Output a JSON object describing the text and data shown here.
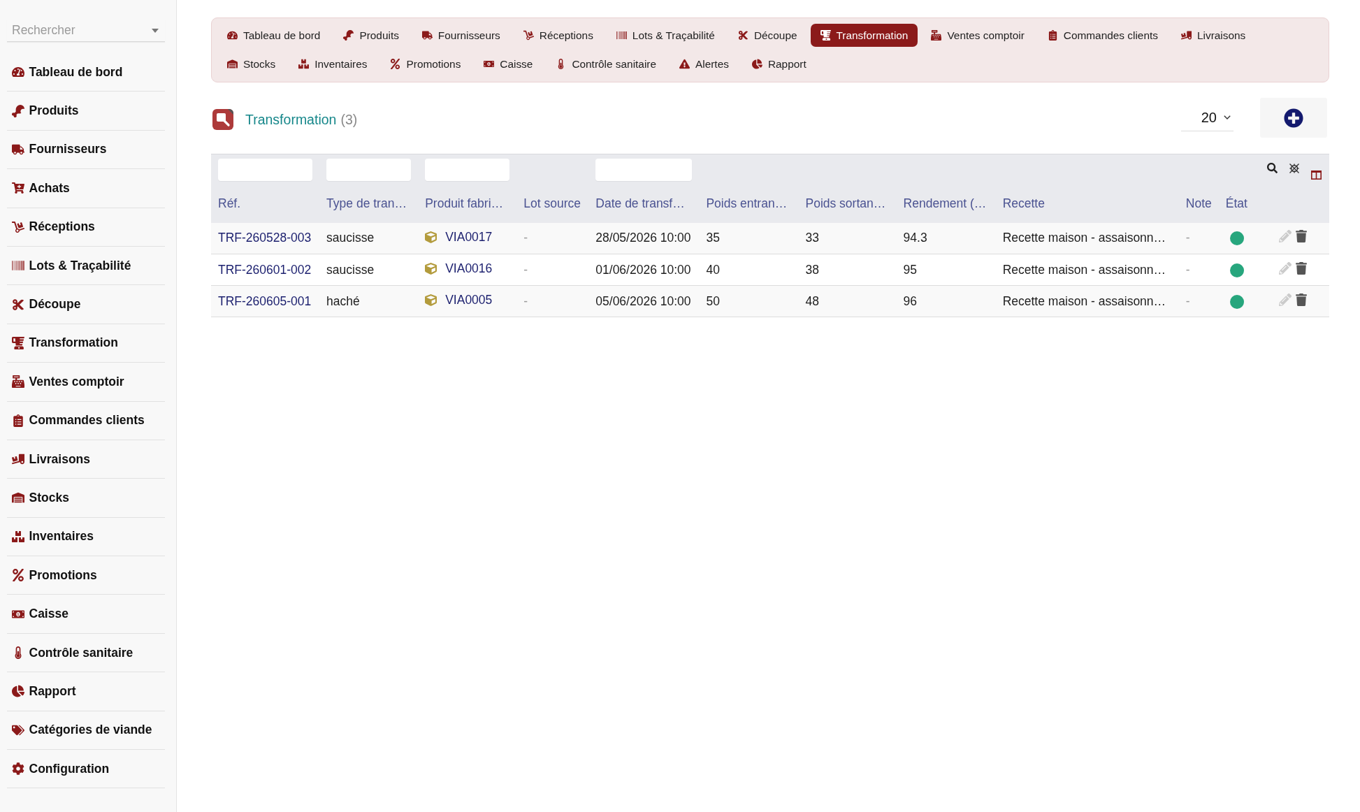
{
  "sidebar": {
    "search": {
      "placeholder": "Rechercher"
    },
    "items": [
      {
        "label": "Tableau de bord"
      },
      {
        "label": "Produits"
      },
      {
        "label": "Fournisseurs"
      },
      {
        "label": "Achats"
      },
      {
        "label": "Réceptions"
      },
      {
        "label": "Lots & Traçabilité"
      },
      {
        "label": "Découpe"
      },
      {
        "label": "Transformation"
      },
      {
        "label": "Ventes comptoir"
      },
      {
        "label": "Commandes clients"
      },
      {
        "label": "Livraisons"
      },
      {
        "label": "Stocks"
      },
      {
        "label": "Inventaires"
      },
      {
        "label": "Promotions"
      },
      {
        "label": "Caisse"
      },
      {
        "label": "Contrôle sanitaire"
      },
      {
        "label": "Rapport"
      },
      {
        "label": "Catégories de viande"
      },
      {
        "label": "Configuration"
      }
    ]
  },
  "nav": {
    "rows": [
      {
        "items": [
          {
            "label": "Tableau de bord",
            "selected": false
          },
          {
            "label": "Produits",
            "selected": false
          },
          {
            "label": "Fournisseurs",
            "selected": false
          },
          {
            "label": "Réceptions",
            "selected": false
          },
          {
            "label": "Lots & Traçabilité",
            "selected": false
          },
          {
            "label": "Découpe",
            "selected": false
          },
          {
            "label": "Transformation",
            "selected": true
          },
          {
            "label": "Ventes comptoir",
            "selected": false
          },
          {
            "label": "Commandes clients",
            "selected": false
          },
          {
            "label": "Livraisons",
            "selected": false
          }
        ]
      },
      {
        "items": [
          {
            "label": "Stocks",
            "selected": false
          },
          {
            "label": "Inventaires",
            "selected": false
          },
          {
            "label": "Promotions",
            "selected": false
          },
          {
            "label": "Caisse",
            "selected": false
          },
          {
            "label": "Contrôle sanitaire",
            "selected": false
          },
          {
            "label": "Alertes",
            "selected": false
          },
          {
            "label": "Rapport",
            "selected": false
          }
        ]
      }
    ]
  },
  "header": {
    "title": "Transformation",
    "count": "(3)",
    "page_size": "20"
  },
  "table": {
    "columns": [
      {
        "label": "Réf.",
        "kind": "link",
        "filter": true
      },
      {
        "label": "Type de tran…",
        "kind": "text",
        "filter": true
      },
      {
        "label": "Produit fabri…",
        "kind": "product",
        "filter": true
      },
      {
        "label": "Lot source",
        "kind": "muted",
        "filter": false
      },
      {
        "label": "Date de transf…",
        "kind": "text",
        "filter": true
      },
      {
        "label": "Poids entran…",
        "kind": "text",
        "filter": false
      },
      {
        "label": "Poids sortan…",
        "kind": "text",
        "filter": false
      },
      {
        "label": "Rendement (…",
        "kind": "text",
        "filter": false
      },
      {
        "label": "Recette",
        "kind": "text",
        "filter": false
      },
      {
        "label": "Note",
        "kind": "muted",
        "filter": false
      },
      {
        "label": "État",
        "kind": "status",
        "filter": false
      }
    ],
    "rows": [
      {
        "cells": [
          "TRF-260528-003",
          "saucisse",
          "VIA0017",
          "-",
          "28/05/2026 10:00",
          "35",
          "33",
          "94.3",
          "Recette maison - assaisonn…",
          "-"
        ],
        "status": {
          "color": "#27a67d"
        },
        "edit_enabled": false
      },
      {
        "cells": [
          "TRF-260601-002",
          "saucisse",
          "VIA0016",
          "-",
          "01/06/2026 10:00",
          "40",
          "38",
          "95",
          "Recette maison - assaisonn…",
          "-"
        ],
        "status": {
          "color": "#27a67d"
        },
        "edit_enabled": false
      },
      {
        "cells": [
          "TRF-260605-001",
          "haché",
          "VIA0005",
          "-",
          "05/06/2026 10:00",
          "50",
          "48",
          "96",
          "Recette maison - assaisonn…",
          "-"
        ],
        "status": {
          "color": "#27a67d"
        },
        "edit_enabled": false
      }
    ]
  }
}
